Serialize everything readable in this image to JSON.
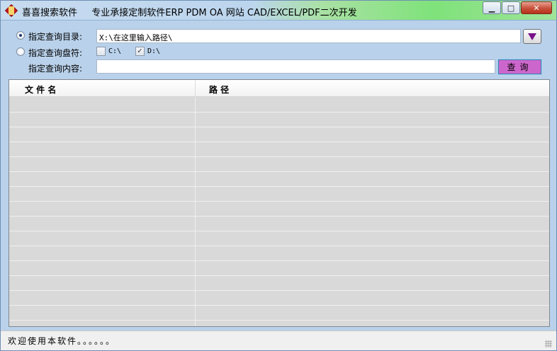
{
  "window": {
    "app_title": "喜喜搜索软件",
    "title_slogan": "专业承接定制软件ERP PDM OA 网站 CAD/EXCEL/PDF二次开发",
    "minimize_glyph": "▁",
    "maximize_glyph": "□",
    "close_glyph": "✕"
  },
  "form": {
    "dir_option_label": "指定查询目录:",
    "dir_option_selected": true,
    "dir_path_value": "X:\\在这里输入路径\\",
    "drive_option_label": "指定查询盘符:",
    "drive_option_selected": false,
    "drives": [
      {
        "label": "C:\\",
        "checked": false
      },
      {
        "label": "D:\\",
        "checked": true
      }
    ],
    "content_label": "指定查询内容:",
    "content_value": "",
    "query_button_label": "查询"
  },
  "list": {
    "columns": [
      "文 件 名",
      "路 径"
    ],
    "rows": []
  },
  "status": {
    "text": "欢迎使用本软件。。。。。。"
  },
  "colors": {
    "window_bg": "#b9d1ea",
    "query_button": "#cc66cc",
    "dropdown_arrow": "#7a0f8c",
    "list_bg": "#d9d9d9"
  }
}
